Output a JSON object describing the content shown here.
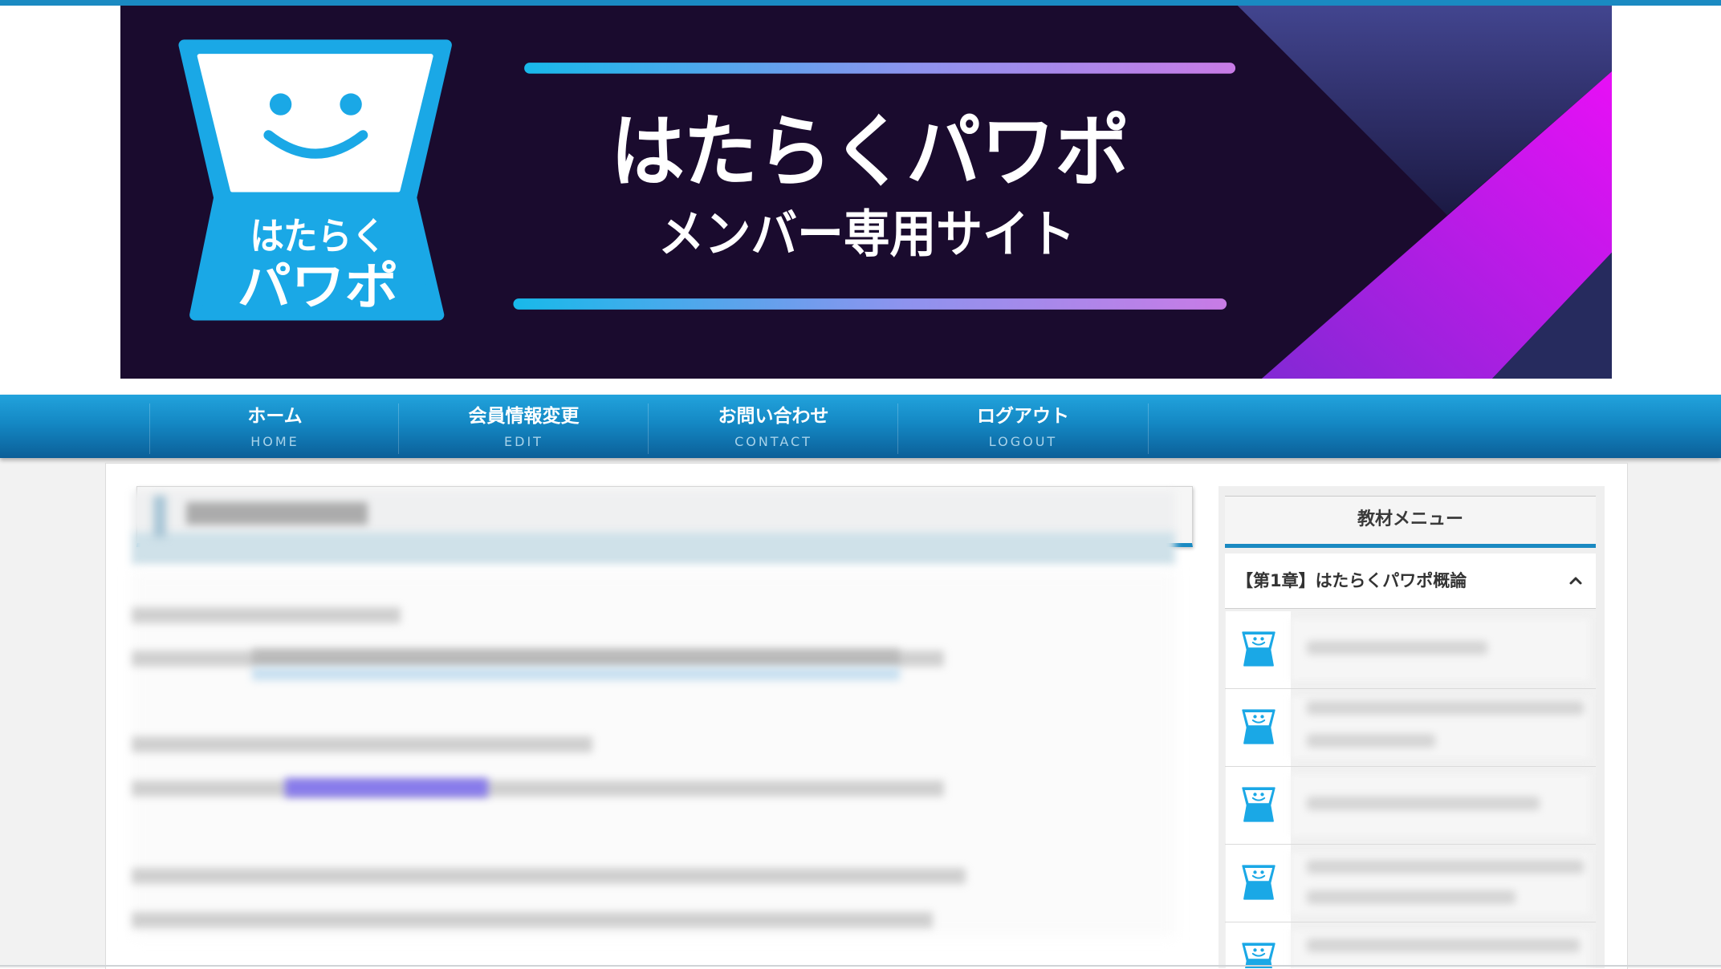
{
  "banner": {
    "logo_line1": "はたらく",
    "logo_line2": "パワポ",
    "title": "はたらくパワポ",
    "subtitle": "メンバー専用サイト"
  },
  "nav": {
    "items": [
      {
        "label": "ホーム",
        "sub": "HOME"
      },
      {
        "label": "会員情報変更",
        "sub": "EDIT"
      },
      {
        "label": "お問い合わせ",
        "sub": "CONTACT"
      },
      {
        "label": "ログアウト",
        "sub": "LOGOUT"
      }
    ]
  },
  "sidebar": {
    "title": "教材メニュー",
    "chapter": {
      "label": "【第1章】はたらくパワポ概論",
      "icon": "chevron-up-icon"
    },
    "lesson_icon": "lesson-thumbnail-icon"
  },
  "colors": {
    "accent": "#1a8ac2",
    "nav_top": "#22a3dc",
    "nav_bottom": "#0b5f98",
    "banner_bg": "#1a0b2e",
    "logo_blue": "#1aa8e6",
    "banner_magenta": "#e50ff5"
  }
}
